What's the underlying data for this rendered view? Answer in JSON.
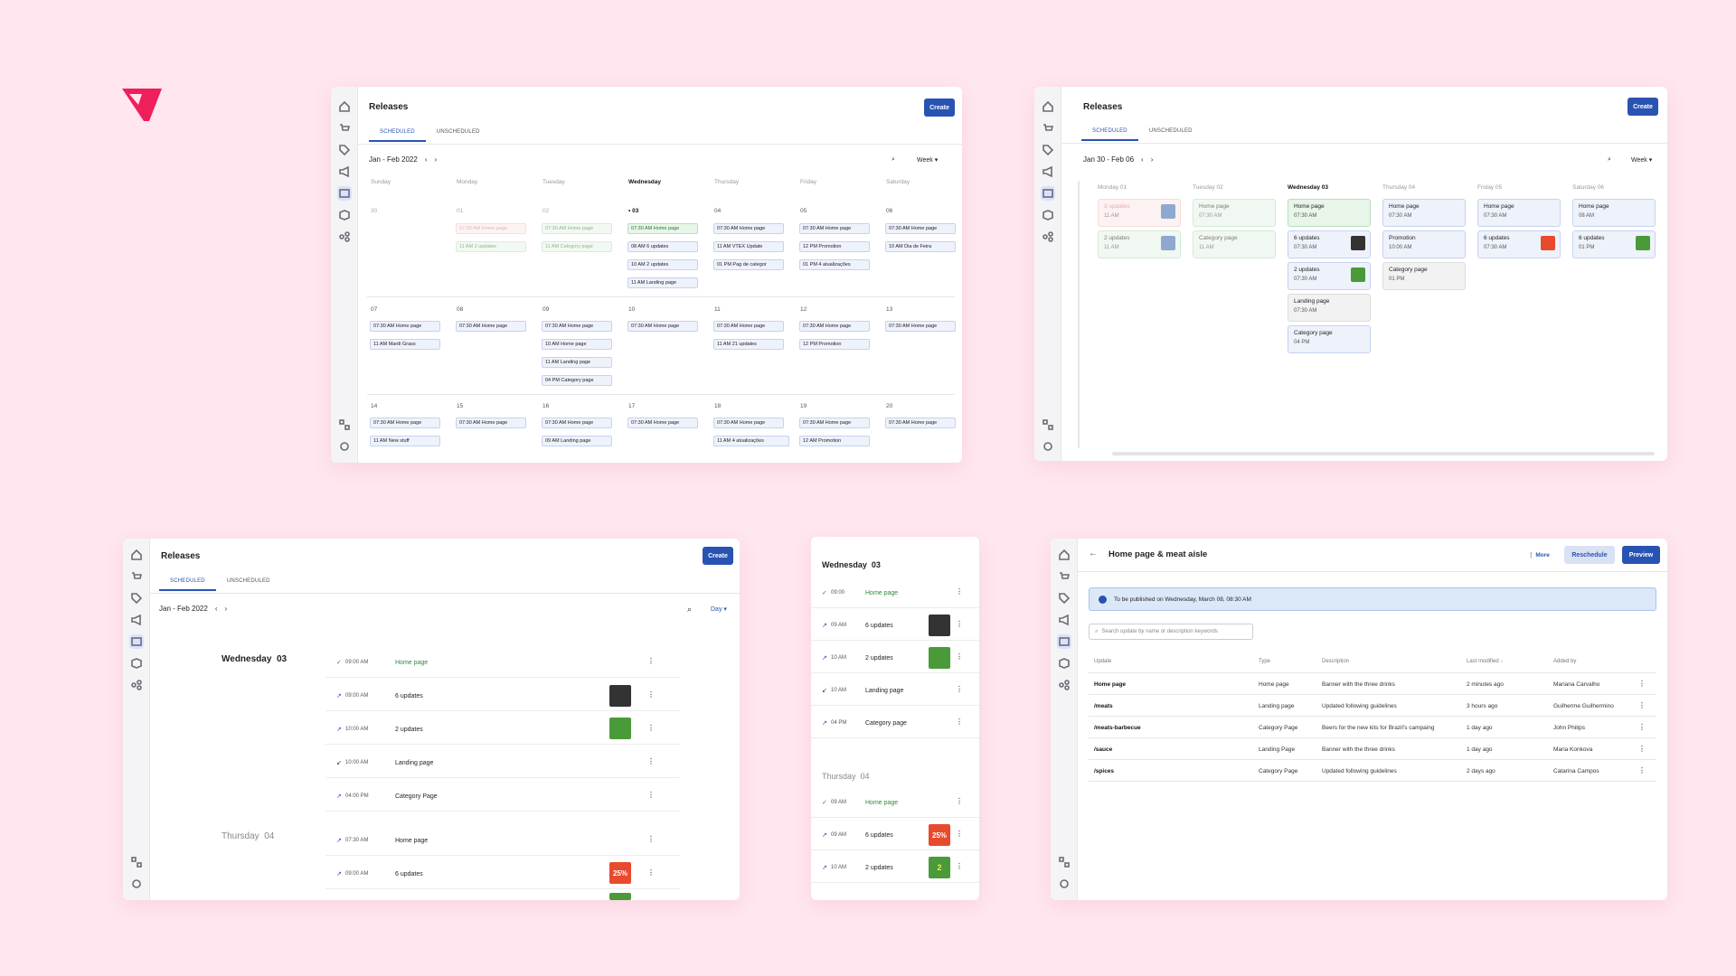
{
  "app": {
    "title": "Releases",
    "create_label": "Create",
    "tab_scheduled": "SCHEDULED",
    "tab_unscheduled": "UNSCHEDULED",
    "brand_color": "#2953b2"
  },
  "week_view": {
    "range": "Jan - Feb 2022",
    "view_select": "Week",
    "days": [
      "Sunday",
      "Monday",
      "Tuesday",
      "Wednesday",
      "Thursday",
      "Friday",
      "Saturday"
    ],
    "weeks": [
      {
        "dates": [
          "30",
          "01",
          "02",
          "• 03",
          "04",
          "05",
          "06"
        ]
      },
      {
        "dates": [
          "07",
          "08",
          "09",
          "10",
          "11",
          "12",
          "13"
        ]
      },
      {
        "dates": [
          "14",
          "15",
          "16",
          "17",
          "18",
          "19",
          "20"
        ]
      }
    ],
    "chips": [
      {
        "text": "07:30 AM Home page"
      },
      {
        "text": "11 AM 2 updates"
      },
      {
        "text": "07:30 AM Home page"
      },
      {
        "text": "11 AM Category page"
      },
      {
        "text": "07:30 AM Home page"
      },
      {
        "text": "08 AM 6 updates"
      },
      {
        "text": "10 AM 2 updates"
      },
      {
        "text": "11 AM Landing page"
      },
      {
        "text": "07:30 AM Home page"
      },
      {
        "text": "11 AM VTEX Update"
      },
      {
        "text": "01 PM Pag de categor"
      },
      {
        "text": "07:30 AM Home page"
      },
      {
        "text": "12 PM Promotion"
      },
      {
        "text": "01 PM 4 atualizações"
      },
      {
        "text": "07:30 AM Home page"
      },
      {
        "text": "10 AM Dia de Feira"
      },
      {
        "text": "07:30 AM Home page"
      },
      {
        "text": "11 AM Mardi Grass"
      },
      {
        "text": "07:30 AM Home page"
      },
      {
        "text": "07:30 AM Home page"
      },
      {
        "text": "10 AM Home page"
      },
      {
        "text": "11 AM Landing page"
      },
      {
        "text": "04 PM Category page"
      },
      {
        "text": "07:30 AM Home page"
      },
      {
        "text": "07:30 AM Home page"
      },
      {
        "text": "11 AM 21 updates"
      },
      {
        "text": "07:30 AM Home page"
      },
      {
        "text": "12 PM Promotion"
      },
      {
        "text": "07:30 AM Home page"
      },
      {
        "text": "07:30 AM Home page"
      },
      {
        "text": "11 AM New stuff"
      },
      {
        "text": "07:30 AM Home page"
      },
      {
        "text": "07:30 AM Home page"
      },
      {
        "text": "09 AM Landing page"
      },
      {
        "text": "07:30 AM Home page"
      },
      {
        "text": "07:30 AM Home page"
      },
      {
        "text": "11 AM 4 atualizações"
      },
      {
        "text": "07:30 AM Home page"
      },
      {
        "text": "12 AM Promotion"
      },
      {
        "text": "07:30 AM Home page"
      }
    ]
  },
  "board_view": {
    "range": "Jan 30 - Feb 06",
    "view_select": "Week",
    "columns": [
      "Monday 01",
      "Tuesday 02",
      "Wednesday 03",
      "Thursday 04",
      "Friday 05",
      "Saturday 06"
    ],
    "cards": [
      {
        "t1": "3 updates",
        "t2": "11 AM"
      },
      {
        "t1": "2 updates",
        "t2": "11 AM"
      },
      {
        "t1": "Home page",
        "t2": "07:30 AM"
      },
      {
        "t1": "Category page",
        "t2": "11 AM"
      },
      {
        "t1": "Home page",
        "t2": "07:30 AM"
      },
      {
        "t1": "6 updates",
        "t2": "07:30 AM"
      },
      {
        "t1": "2 updates",
        "t2": "07:30 AM"
      },
      {
        "t1": "Landing page",
        "t2": "07:30 AM"
      },
      {
        "t1": "Category page",
        "t2": "04 PM"
      },
      {
        "t1": "Home page",
        "t2": "07:30 AM"
      },
      {
        "t1": "Promotion",
        "t2": "10:00 AM"
      },
      {
        "t1": "Category page",
        "t2": "01 PM"
      },
      {
        "t1": "Home page",
        "t2": "07:30 AM"
      },
      {
        "t1": "6 updates",
        "t2": "07:30 AM"
      },
      {
        "t1": "Home page",
        "t2": "08 AM"
      },
      {
        "t1": "6 updates",
        "t2": "01 PM"
      }
    ]
  },
  "day_view": {
    "range": "Jan - Feb 2022",
    "view_select": "Day",
    "wed_label": "Wednesday",
    "wed_num": "03",
    "thu_label": "Thursday",
    "thu_num": "04",
    "wed_rows": [
      {
        "time": "09:00 AM",
        "name": "Home page"
      },
      {
        "time": "09:00 AM",
        "name": "6 updates"
      },
      {
        "time": "10:00 AM",
        "name": "2 updates"
      },
      {
        "time": "10:00 AM",
        "name": "Landing page"
      },
      {
        "time": "04:00 PM",
        "name": "Category Page"
      }
    ],
    "thu_rows": [
      {
        "time": "07:30 AM",
        "name": "Home page"
      },
      {
        "time": "09:00 AM",
        "name": "6 updates"
      }
    ]
  },
  "mobile_view": {
    "wed_label": "Wednesday",
    "wed_num": "03",
    "thu_label": "Thursday",
    "thu_num": "04",
    "wed_rows": [
      {
        "time": "09:00",
        "name": "Home page"
      },
      {
        "time": "09 AM",
        "name": "6 updates"
      },
      {
        "time": "10 AM",
        "name": "2 updates"
      },
      {
        "time": "10 AM",
        "name": "Landing page"
      },
      {
        "time": "04 PM",
        "name": "Category page"
      }
    ],
    "thu_rows": [
      {
        "time": "09 AM",
        "name": "Home page"
      },
      {
        "time": "09 AM",
        "name": "6 updates"
      },
      {
        "time": "10 AM",
        "name": "2 updates"
      }
    ]
  },
  "detail_view": {
    "title": "Home page & meat aisle",
    "more": "More",
    "reschedule": "Reschedule",
    "preview": "Preview",
    "banner": "To be published on Wednesday, March 08, 08:30 AM",
    "search_placeholder": "Search update by name or description keywords",
    "headers": [
      "Update",
      "Type",
      "Description",
      "Last modified",
      "Added by"
    ],
    "rows": [
      {
        "update": "Home page",
        "type": "Home page",
        "desc": "Banner with the three drinks",
        "mod": "2 minutes ago",
        "by": "Mariana Carvalho"
      },
      {
        "update": "/meats",
        "type": "Landing page",
        "desc": "Updated following guidelines",
        "mod": "3 hours ago",
        "by": "Guilherme Guilhermino"
      },
      {
        "update": "/meats-barbecue",
        "type": "Category Page",
        "desc": "Beers for the new kits for Brazil's campaing",
        "mod": "1 day ago",
        "by": "John Philips"
      },
      {
        "update": "/sauce",
        "type": "Landing Page",
        "desc": "Banner with the three drinks",
        "mod": "1 day ago",
        "by": "Maria Konkova"
      },
      {
        "update": "/spices",
        "type": "Category Page",
        "desc": "Updated following guidelines",
        "mod": "2 days ago",
        "by": "Catarina Campos"
      }
    ]
  },
  "thumbs": {
    "t1": "25%",
    "t2": "2"
  }
}
